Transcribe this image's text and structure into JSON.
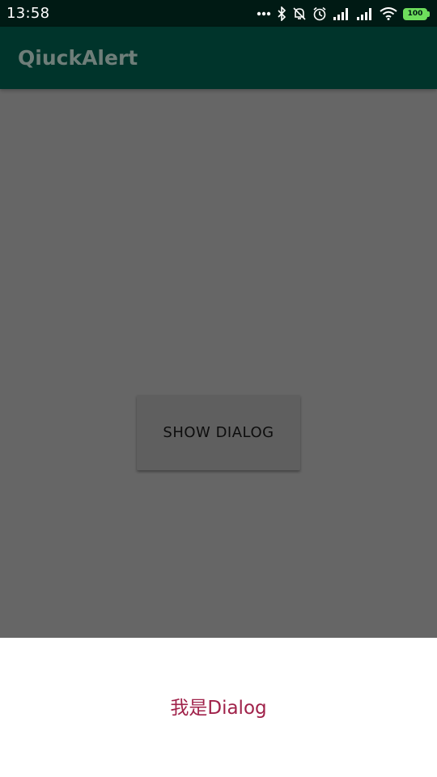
{
  "status_bar": {
    "time": "13:58",
    "battery_level": "100",
    "icons": [
      "more-dots-icon",
      "bluetooth-icon",
      "mute-icon",
      "alarm-icon",
      "signal-icon",
      "signal-icon",
      "wifi-icon",
      "battery-icon"
    ]
  },
  "app_bar": {
    "title": "QiuckAlert"
  },
  "main": {
    "show_dialog_label": "SHOW DIALOG"
  },
  "dialog": {
    "message": "我是Dialog"
  },
  "colors": {
    "status_bar_bg": "#001a14",
    "app_bar_bg": "#00342b",
    "scrim": "#666666",
    "dialog_text": "#a0224a",
    "battery": "#6ede5c"
  }
}
